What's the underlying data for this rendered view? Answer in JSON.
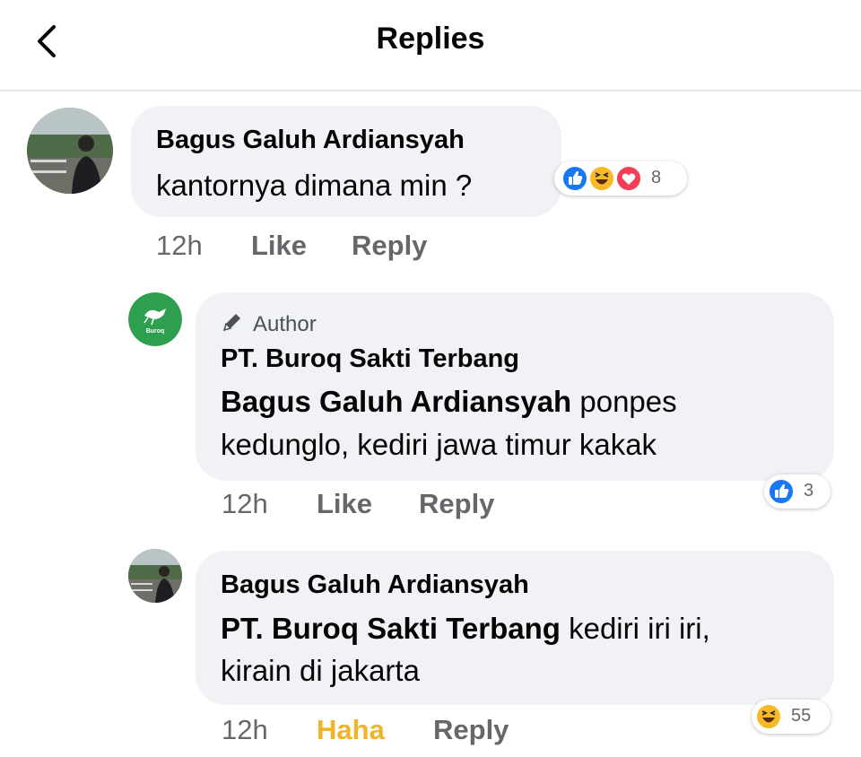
{
  "header": {
    "title": "Replies"
  },
  "comments": [
    {
      "author": "Bagus Galuh Ardiansyah",
      "text": "kantornya dimana min ?",
      "time": "12h",
      "like": "Like",
      "reply": "Reply",
      "reactions": {
        "icons": [
          "like-icon",
          "haha-icon",
          "love-icon"
        ],
        "count": "8"
      }
    },
    {
      "badge": "Author",
      "author": "PT. Buroq Sakti Terbang",
      "avatar_text": "Buroq",
      "mention": "Bagus Galuh Ardiansyah",
      "text_after_mention": " ponpes",
      "text_line2": "kedunglo, kediri jawa timur kakak",
      "time": "12h",
      "like": "Like",
      "reply": "Reply",
      "reactions": {
        "icons": [
          "like-icon"
        ],
        "count": "3"
      }
    },
    {
      "author": "Bagus Galuh Ardiansyah",
      "mention": "PT. Buroq Sakti Terbang",
      "text_after_mention": " kediri iri iri,",
      "text_line2": "kirain di jakarta",
      "time": "12h",
      "like": "Haha",
      "reply": "Reply",
      "reactions": {
        "icons": [
          "haha-icon"
        ],
        "count": "55"
      }
    }
  ],
  "colors": {
    "like_blue": "#1877f2",
    "haha_yellow": "#f7b928",
    "love_red": "#f33e58",
    "brand_green": "#2e9e4f"
  }
}
